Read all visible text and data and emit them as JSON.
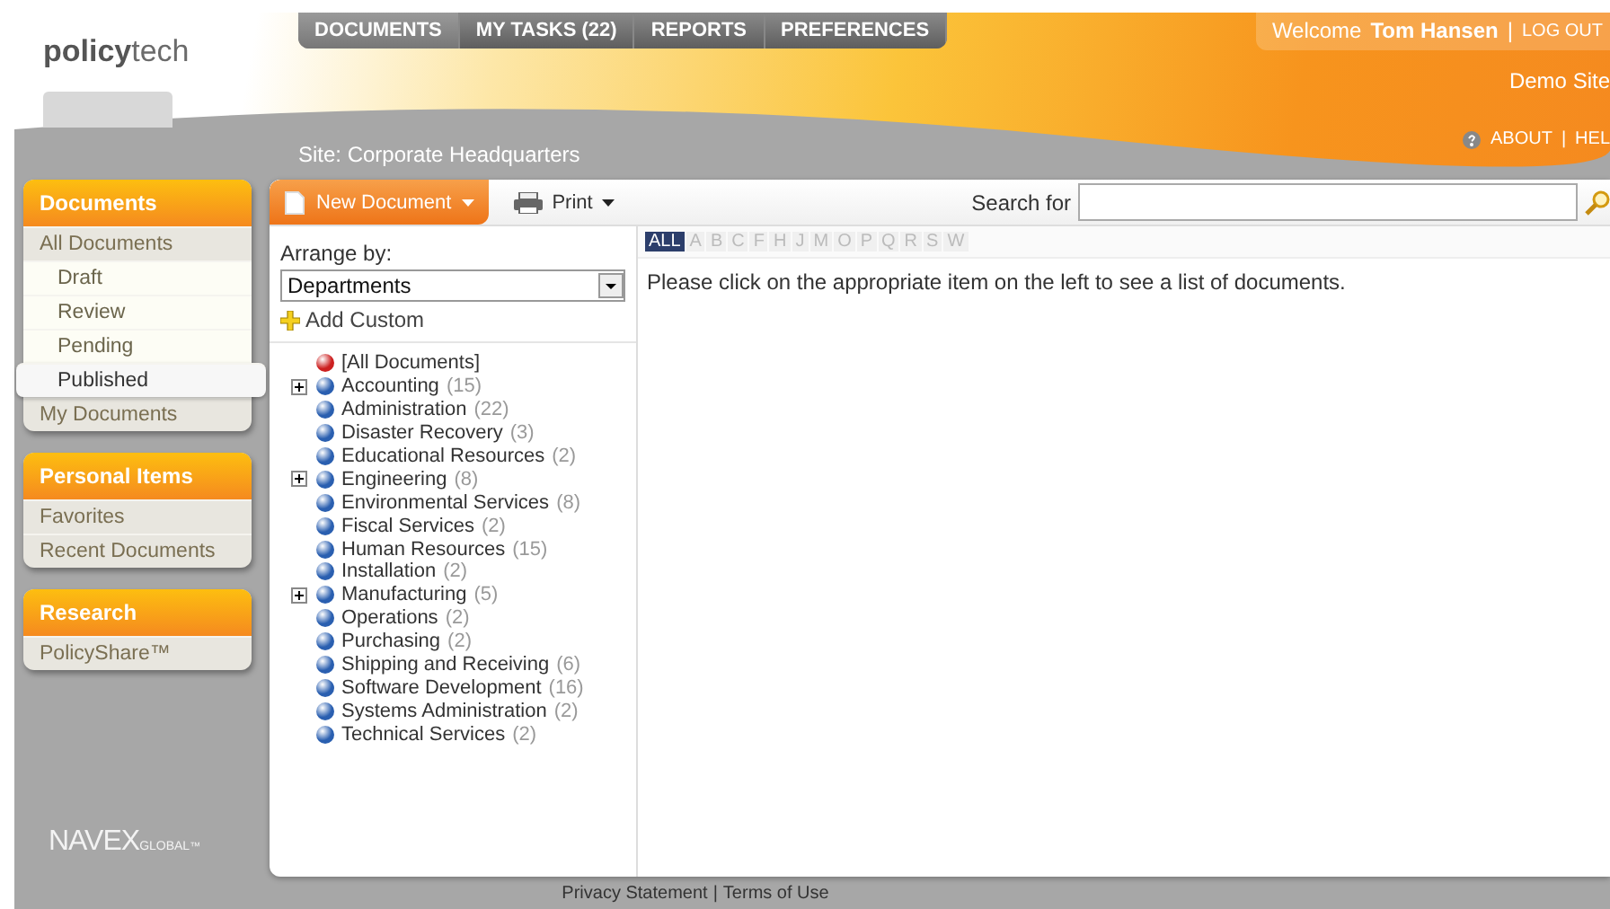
{
  "logo": {
    "text": "**policy**tech"
  },
  "tabs": [
    {
      "label": "DOCUMENTS",
      "selected": true
    },
    {
      "label": "MY TASKS (22)",
      "selected": false
    },
    {
      "label": "REPORTS",
      "selected": false
    },
    {
      "label": "PREFERENCES",
      "selected": false
    }
  ],
  "user": {
    "welcome": "Welcome",
    "name": "Tom Hansen",
    "sep": "|",
    "logout": "LOG OUT"
  },
  "site_name": "Demo Site",
  "site_label": "Site:  Corporate Headquarters",
  "header_links": [
    {
      "label": "ABOUT",
      "sep": "|"
    },
    {
      "label": "HEL"
    }
  ],
  "sidebar": [
    {
      "title": "Documents",
      "items": [
        {
          "label": "All Documents",
          "kind": "top",
          "selected": false
        },
        {
          "label": "Draft",
          "kind": "sub",
          "selected": false
        },
        {
          "label": "Review",
          "kind": "sub",
          "selected": false
        },
        {
          "label": "Pending",
          "kind": "sub",
          "selected": false
        },
        {
          "label": "Published",
          "kind": "sub",
          "selected": true
        },
        {
          "label": "My Documents",
          "kind": "top",
          "selected": false
        }
      ]
    },
    {
      "title": "Personal Items",
      "items": [
        {
          "label": "Favorites",
          "kind": "top",
          "selected": false
        },
        {
          "label": "Recent Documents",
          "kind": "top",
          "selected": false
        }
      ]
    },
    {
      "title": "Research",
      "items": [
        {
          "label": "PolicyShare™",
          "kind": "top",
          "selected": false
        }
      ]
    }
  ],
  "brand": {
    "main": "NAVEX",
    "sub": "GLOBAL",
    "mark": "™"
  },
  "toolbar": {
    "new_button": "New Document",
    "print_button": "Print",
    "search_label": "Search for"
  },
  "arrange": {
    "label": "Arrange by:",
    "value": "Departments",
    "add_custom": "Add Custom"
  },
  "tree": [
    {
      "name": "[All Documents]",
      "color": "#cc2020",
      "has_children": false
    },
    {
      "name": "Accounting",
      "count": "(15)",
      "color": "#2a5fb0",
      "has_children": true
    },
    {
      "name": "Administration",
      "count": "(22)",
      "color": "#2a5fb0",
      "has_children": false
    },
    {
      "name": "Disaster Recovery",
      "count": "(3)",
      "color": "#2a5fb0",
      "has_children": false
    },
    {
      "name": "Educational Resources",
      "count": "(2)",
      "color": "#2a5fb0",
      "has_children": false
    },
    {
      "name": "Engineering",
      "count": "(8)",
      "color": "#2a5fb0",
      "has_children": true
    },
    {
      "name": "Environmental Services",
      "count": "(8)",
      "color": "#2a5fb0",
      "has_children": false
    },
    {
      "name": "Fiscal Services",
      "count": "(2)",
      "color": "#2a5fb0",
      "has_children": false
    },
    {
      "name": "Human Resources",
      "count": "(15)",
      "color": "#2a5fb0",
      "has_children": false
    },
    {
      "name": "Installation",
      "count": "(2)",
      "color": "#2a5fb0",
      "has_children": false
    },
    {
      "name": "Manufacturing",
      "count": "(5)",
      "color": "#2a5fb0",
      "has_children": true
    },
    {
      "name": "Operations",
      "count": "(2)",
      "color": "#2a5fb0",
      "has_children": false
    },
    {
      "name": "Purchasing",
      "count": "(2)",
      "color": "#2a5fb0",
      "has_children": false
    },
    {
      "name": "Shipping and Receiving",
      "count": "(6)",
      "color": "#2a5fb0",
      "has_children": false
    },
    {
      "name": "Software Development",
      "count": "(16)",
      "color": "#2a5fb0",
      "has_children": false
    },
    {
      "name": "Systems Administration",
      "count": "(2)",
      "color": "#2a5fb0",
      "has_children": false
    },
    {
      "name": "Technical Services",
      "count": "(2)",
      "color": "#2a5fb0",
      "has_children": false
    }
  ],
  "letters": [
    {
      "label": "ALL",
      "selected": true
    },
    {
      "label": "A",
      "selected": false
    },
    {
      "label": "B",
      "selected": false
    },
    {
      "label": "C",
      "selected": false
    },
    {
      "label": "F",
      "selected": false
    },
    {
      "label": "H",
      "selected": false
    },
    {
      "label": "J",
      "selected": false
    },
    {
      "label": "M",
      "selected": false
    },
    {
      "label": "O",
      "selected": false
    },
    {
      "label": "P",
      "selected": false
    },
    {
      "label": "Q",
      "selected": false
    },
    {
      "label": "R",
      "selected": false
    },
    {
      "label": "S",
      "selected": false
    },
    {
      "label": "W",
      "selected": false
    }
  ],
  "message": "Please click on the appropriate item on the left to see a list of documents.",
  "footer": {
    "privacy": "Privacy Statement",
    "sep": "|",
    "terms": "Terms of Use"
  }
}
